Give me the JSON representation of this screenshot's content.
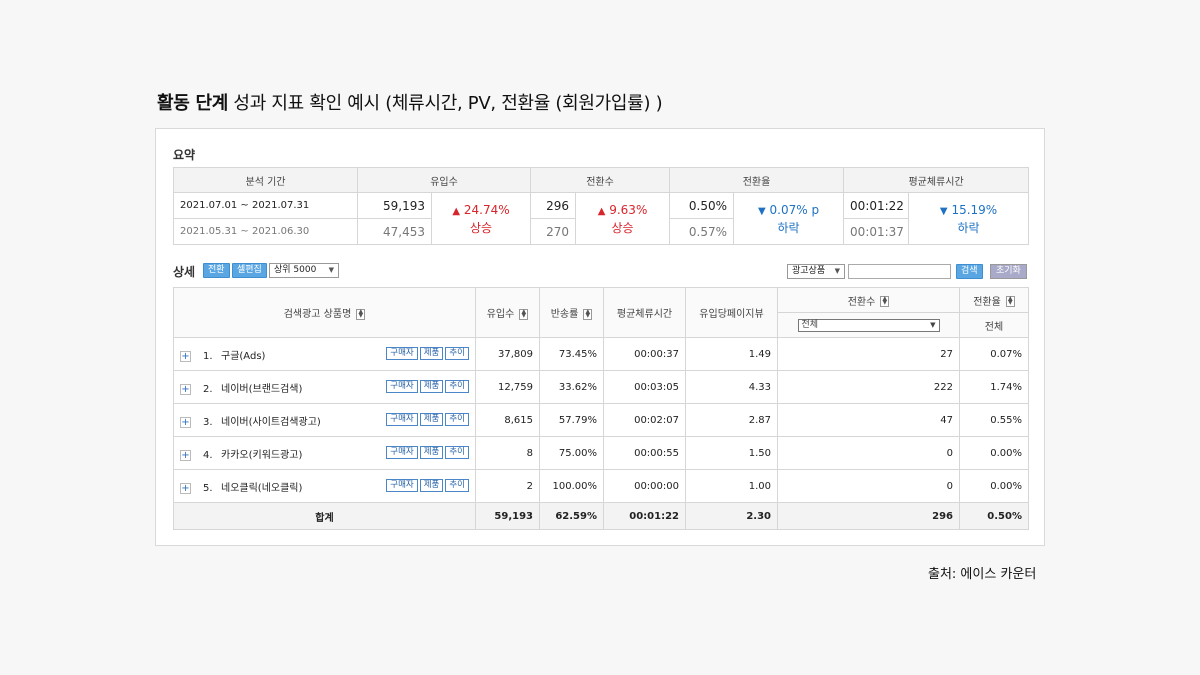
{
  "slide": {
    "title_bold": "활동 단계",
    "title_rest": " 성과 지표 확인 예시 (체류시간, PV, 전환율 (회원가입률) )",
    "source": "출처: 에이스 카운터"
  },
  "summary": {
    "label": "요약",
    "headers": [
      "분석 기간",
      "유입수",
      "전환수",
      "전환율",
      "평균체류시간"
    ],
    "current_period": "2021.07.01 ~ 2021.07.31",
    "previous_period": "2021.05.31 ~ 2021.06.30",
    "inflow": {
      "current": "59,193",
      "previous": "47,453",
      "change": "24.74%",
      "dir": "상승"
    },
    "conversions": {
      "current": "296",
      "previous": "270",
      "change": "9.63%",
      "dir": "상승"
    },
    "conv_rate": {
      "current": "0.50%",
      "previous": "0.57%",
      "change": "0.07% p",
      "dir": "하락"
    },
    "avg_stay": {
      "current": "00:01:22",
      "previous": "00:01:37",
      "change": "15.19%",
      "dir": "하락"
    },
    "colors": {
      "up": "#d8252b",
      "down": "#1f72c3"
    }
  },
  "detail": {
    "label": "상세",
    "btn_convert": "전환",
    "btn_cell_edit": "셀편집",
    "top_select": "상위 5000",
    "ad_select": "광고상품",
    "search_button": "검색",
    "reset_button": "초기화",
    "headers": {
      "product": "검색광고 상품명",
      "inflow": "유입수",
      "bounce": "반송률",
      "avg_stay": "평균체류시간",
      "pv_per_visit": "유입당페이지뷰",
      "conversions": "전환수",
      "conv_rate": "전환율",
      "conv_filter": "전체",
      "conv_rate_sub": "전체"
    },
    "tag_labels": [
      "구매자",
      "제품",
      "추이"
    ],
    "rows": [
      {
        "idx": "1.",
        "name": "구글(Ads)",
        "inflow": "37,809",
        "bounce": "73.45%",
        "stay": "00:00:37",
        "pv": "1.49",
        "conv": "27",
        "rate": "0.07%"
      },
      {
        "idx": "2.",
        "name": "네이버(브랜드검색)",
        "inflow": "12,759",
        "bounce": "33.62%",
        "stay": "00:03:05",
        "pv": "4.33",
        "conv": "222",
        "rate": "1.74%"
      },
      {
        "idx": "3.",
        "name": "네이버(사이트검색광고)",
        "inflow": "8,615",
        "bounce": "57.79%",
        "stay": "00:02:07",
        "pv": "2.87",
        "conv": "47",
        "rate": "0.55%"
      },
      {
        "idx": "4.",
        "name": "카카오(키워드광고)",
        "inflow": "8",
        "bounce": "75.00%",
        "stay": "00:00:55",
        "pv": "1.50",
        "conv": "0",
        "rate": "0.00%"
      },
      {
        "idx": "5.",
        "name": "네오클릭(네오클릭)",
        "inflow": "2",
        "bounce": "100.00%",
        "stay": "00:00:00",
        "pv": "1.00",
        "conv": "0",
        "rate": "0.00%"
      }
    ],
    "total": {
      "label": "합계",
      "inflow": "59,193",
      "bounce": "62.59%",
      "stay": "00:01:22",
      "pv": "2.30",
      "conv": "296",
      "rate": "0.50%"
    }
  }
}
